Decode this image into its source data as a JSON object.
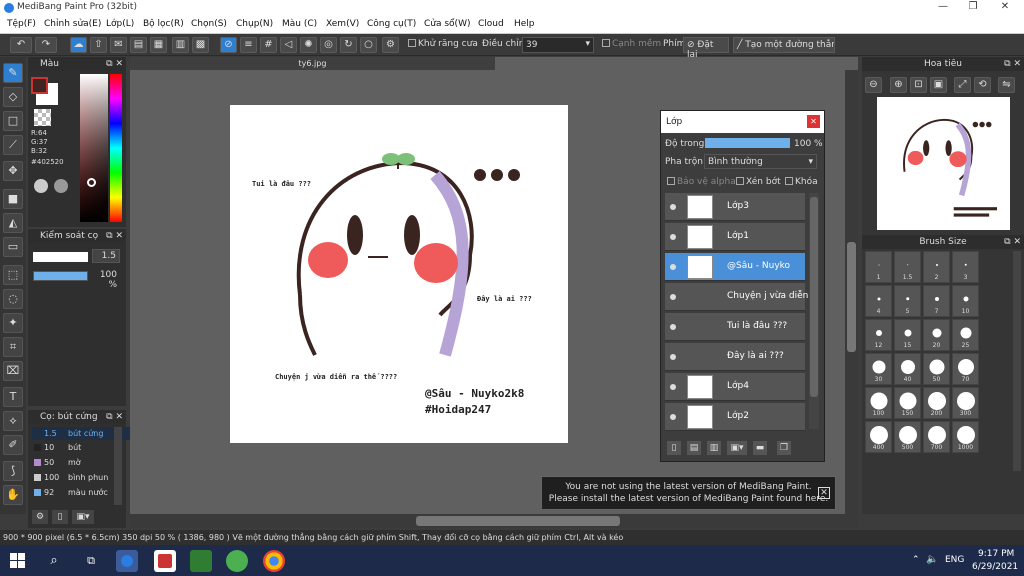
{
  "window": {
    "title": "MediBang Paint Pro (32bit)"
  },
  "menu": [
    "Tệp(F)",
    "Chỉnh sửa(E)",
    "Lớp(L)",
    "Bộ lọc(R)",
    "Chọn(S)",
    "Chụp(N)",
    "Màu (C)",
    "Xem(V)",
    "Công cụ(T)",
    "Cửa sổ(W)",
    "Cloud",
    "Help"
  ],
  "toolbar": {
    "antialias": "Khử răng cưa",
    "adjust_label": "Điều chỉnh",
    "adjust_value": "39",
    "soft_edge": "Cạnh mềm",
    "shortcut": "Phím",
    "set": "Đặt lại",
    "make_line": "Tạo một đường thẳng"
  },
  "color_panel": {
    "title": "Màu",
    "r": "R:64",
    "g": "G:37",
    "b": "B:32",
    "hex": "#402520",
    "fg": "#402520"
  },
  "control_panel": {
    "title": "Kiểm soát cọ",
    "size": "1.5",
    "opacity": "100 %",
    "opacity_value": 1.0
  },
  "brush_panel": {
    "title": "Cọ: bút cứng",
    "items": [
      {
        "size": "1.5",
        "name": "bút cứng"
      },
      {
        "size": "10",
        "name": "bút"
      },
      {
        "size": "50",
        "name": "mờ"
      },
      {
        "size": "100",
        "name": "bình phun"
      },
      {
        "size": "92",
        "name": "màu nước"
      }
    ]
  },
  "canvas": {
    "tab": "ty6.jpg"
  },
  "artwork": {
    "t1": "Tui là đâu ???",
    "t2": "Đây là ai ???",
    "t3": "Chuyện j vừa diễn ra thế ????",
    "t4": "@Sâu - Nuyko2k8",
    "t5": "#Hoidap247"
  },
  "layers": {
    "title": "Lớp",
    "opacity_label": "Độ trong",
    "opacity": "100 %",
    "blend_label": "Pha trộn",
    "blend": "Bình thường",
    "protect": "Bảo vệ alpha",
    "clip": "Xén bớt",
    "lock": "Khóa",
    "items": [
      "Lớp3",
      "Lớp1",
      "@Sâu - Nuyko",
      "Chuyện j vừa diễn",
      "Tui là đâu ???",
      "Đây là ai ???",
      "Lớp4",
      "Lớp2"
    ]
  },
  "navigator": {
    "title": "Hoa tiêu"
  },
  "brush_size": {
    "title": "Brush Size",
    "sizes": [
      "1",
      "1.5",
      "2",
      "3",
      "4",
      "5",
      "7",
      "10",
      "12",
      "15",
      "20",
      "25",
      "30",
      "40",
      "50",
      "70",
      "100",
      "150",
      "200",
      "300",
      "400",
      "500",
      "700",
      "1000"
    ]
  },
  "notification": {
    "line1": "You are not using the latest version of MediBang Paint.",
    "line2": "Please install the latest version of MediBang Paint found here."
  },
  "status": {
    "text": "900 * 900 pixel  (6.5 * 6.5cm)  350 dpi  50 %  ( 1386, 980 )  Vẽ một đường thẳng bằng cách giữ phím Shift, Thay đổi cỡ cọ bằng cách giữ phím Ctrl, Alt và kéo"
  },
  "taskbar": {
    "lang": "ENG",
    "time": "9:17 PM",
    "date": "6/29/2021"
  }
}
